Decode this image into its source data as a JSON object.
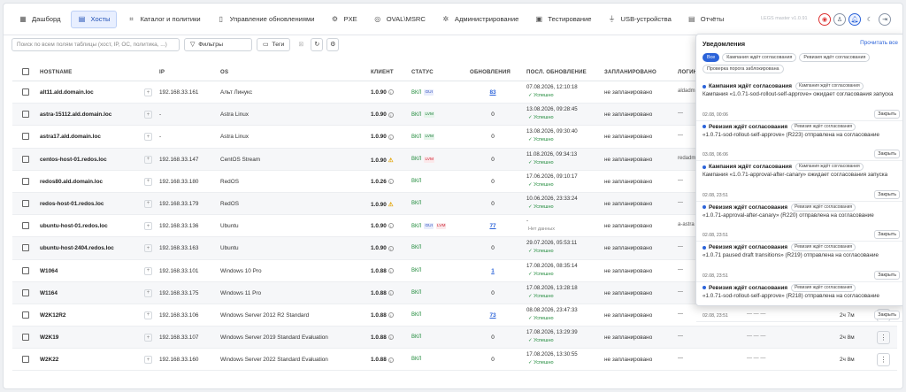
{
  "nav": {
    "tabs": [
      {
        "label": "Дашборд",
        "icon": "grid-icon",
        "glyph": "▦"
      },
      {
        "label": "Хосты",
        "icon": "server-icon",
        "glyph": "▤"
      },
      {
        "label": "Каталог и политики",
        "icon": "tag-icon",
        "glyph": "⌗"
      },
      {
        "label": "Управление обновлениями",
        "icon": "file-icon",
        "glyph": "▯"
      },
      {
        "label": "PXE",
        "icon": "gear-icon",
        "glyph": "⚙"
      },
      {
        "label": "OVAL\\MSRC",
        "icon": "shield-icon",
        "glyph": "◎"
      },
      {
        "label": "Администрирование",
        "icon": "wrench-icon",
        "glyph": "✲"
      },
      {
        "label": "Тестирование",
        "icon": "test-icon",
        "glyph": "▣"
      },
      {
        "label": "USB-устройства",
        "icon": "usb-icon",
        "glyph": "⏚"
      },
      {
        "label": "Отчёты",
        "icon": "report-icon",
        "glyph": "▤"
      }
    ],
    "version": "LEGS master v1.0.91"
  },
  "toolbar": {
    "search_placeholder": "Поиск по всем полям таблицы (хост, IP, ОС, политика, ...)",
    "filters_label": "Фильтры",
    "tags_label": "Теги"
  },
  "table": {
    "headers": {
      "hostname": "HOSTNAME",
      "ip": "IP",
      "os": "OS",
      "client": "КЛИЕНТ",
      "status": "СТАТУС",
      "updates": "ОБНОВЛЕНИЯ",
      "last_update": "ПОСЛ. ОБНОВЛЕНИЕ",
      "scheduled": "ЗАПЛАНИРОВАНО",
      "login": "ЛОГИН"
    },
    "rows": [
      {
        "host": "alt11.ald.domain.loc",
        "ip": "192.168.33.161",
        "os": "Альт Линукс",
        "client": "1.0.90",
        "warn": false,
        "status": "ВКЛ",
        "badges": [
          [
            "GUI",
            "gui"
          ]
        ],
        "updates": "83",
        "link": true,
        "date": "07.08.2026, 12:10:18",
        "result": "✓ Успешно",
        "plan": "не запланировано",
        "cut": "aldadm",
        "age": "",
        "kebab": false
      },
      {
        "host": "astra-15112.ald.domain.loc",
        "ip": "-",
        "os": "Astra Linux",
        "client": "1.0.90",
        "warn": false,
        "status": "ВКЛ",
        "badges": [
          [
            "LVM",
            "lvm"
          ]
        ],
        "updates": "0",
        "link": false,
        "date": "13.08.2026, 09:28:45",
        "result": "✓ Успешно",
        "plan": "не запланировано",
        "cut": "—",
        "age": "",
        "kebab": false
      },
      {
        "host": "astra17.ald.domain.loc",
        "ip": "-",
        "os": "Astra Linux",
        "client": "1.0.90",
        "warn": false,
        "status": "ВКЛ",
        "badges": [
          [
            "LVM",
            "lvm"
          ]
        ],
        "updates": "0",
        "link": false,
        "date": "13.08.2026, 09:30:40",
        "result": "✓ Успешно",
        "plan": "не запланировано",
        "cut": "—",
        "age": "",
        "kebab": false
      },
      {
        "host": "centos-host-01.redos.loc",
        "ip": "192.168.33.147",
        "os": "CentOS Stream",
        "client": "1.0.90",
        "warn": true,
        "status": "ВКЛ",
        "badges": [
          [
            "LVM",
            "lvmr"
          ]
        ],
        "updates": "0",
        "link": false,
        "date": "11.08.2026, 09:34:13",
        "result": "✓ Успешно",
        "plan": "не запланировано",
        "cut": "redadmin",
        "age": "",
        "kebab": false
      },
      {
        "host": "redos80.ald.domain.loc",
        "ip": "192.168.33.180",
        "os": "RedOS",
        "client": "1.0.26",
        "warn": false,
        "status": "ВКЛ",
        "badges": [],
        "updates": "0",
        "link": false,
        "date": "17.06.2026, 09:10:17",
        "result": "✓ Успешно",
        "plan": "не запланировано",
        "cut": "—",
        "age": "",
        "kebab": false
      },
      {
        "host": "redos-host-01.redos.loc",
        "ip": "192.168.33.179",
        "os": "RedOS",
        "client": "1.0.90",
        "warn": true,
        "status": "ВКЛ",
        "badges": [],
        "updates": "0",
        "link": false,
        "date": "10.06.2026, 23:33:24",
        "result": "✓ Успешно",
        "plan": "не запланировано",
        "cut": "—",
        "age": "",
        "kebab": false
      },
      {
        "host": "ubuntu-host-01.redos.loc",
        "ip": "192.168.33.136",
        "os": "Ubuntu",
        "client": "1.0.90",
        "warn": false,
        "status": "ВКЛ",
        "badges": [
          [
            "GUI",
            "gui"
          ],
          [
            "LVM",
            "lvmr"
          ]
        ],
        "updates": "77",
        "link": true,
        "date": "-",
        "result": "Нет данных",
        "nodata": true,
        "plan": "не запланировано",
        "cut": "a-astra",
        "age": "",
        "kebab": false
      },
      {
        "host": "ubuntu-host-2404.redos.loc",
        "ip": "192.168.33.163",
        "os": "Ubuntu",
        "client": "1.0.90",
        "warn": false,
        "status": "ВКЛ",
        "badges": [],
        "updates": "0",
        "link": false,
        "date": "29.07.2026, 05:53:11",
        "result": "✓ Успешно",
        "plan": "не запланировано",
        "cut": "—",
        "age": "",
        "kebab": false
      },
      {
        "host": "W1064",
        "ip": "192.168.33.101",
        "os": "Windows 10 Pro",
        "client": "1.0.88",
        "warn": false,
        "status": "ВКЛ",
        "badges": [],
        "updates": "1",
        "link": true,
        "date": "17.08.2026, 08:35:14",
        "result": "✓ Успешно",
        "plan": "не запланировано",
        "cut": "—",
        "age": "",
        "kebab": false
      },
      {
        "host": "W1164",
        "ip": "192.168.33.175",
        "os": "Windows 11 Pro",
        "client": "1.0.88",
        "warn": false,
        "status": "ВКЛ",
        "badges": [],
        "updates": "0",
        "link": false,
        "date": "17.08.2026, 13:28:18",
        "result": "✓ Успешно",
        "plan": "не запланировано",
        "cut": "—",
        "age": "",
        "kebab": false
      },
      {
        "host": "W2K12R2",
        "ip": "192.168.33.106",
        "os": "Windows Server 2012 R2 Standard",
        "client": "1.0.88",
        "warn": false,
        "status": "ВКЛ",
        "badges": [],
        "updates": "73",
        "link": true,
        "date": "08.08.2026, 23:47:33",
        "result": "✓ Успешно",
        "plan": "не запланировано",
        "cut": "—",
        "age": "2ч 7м",
        "kebab": true
      },
      {
        "host": "W2K19",
        "ip": "192.168.33.107",
        "os": "Windows Server 2019 Standard Evaluation",
        "client": "1.0.88",
        "warn": false,
        "status": "ВКЛ",
        "badges": [],
        "updates": "0",
        "link": false,
        "date": "17.08.2026, 13:29:39",
        "result": "✓ Успешно",
        "plan": "не запланировано",
        "cut": "—",
        "age": "2ч 8м",
        "kebab": true
      },
      {
        "host": "W2K22",
        "ip": "192.168.33.160",
        "os": "Windows Server 2022 Standard Evaluation",
        "client": "1.0.88",
        "warn": false,
        "status": "ВКЛ",
        "badges": [],
        "updates": "0",
        "link": false,
        "date": "17.08.2026, 13:30:55",
        "result": "✓ Успешно",
        "plan": "не запланировано",
        "cut": "—",
        "age": "2ч 8м",
        "kebab": true
      }
    ]
  },
  "notifications": {
    "title": "Уведомления",
    "read_all": "Прочитать все",
    "chips": [
      "Все",
      "Кампания ждёт согласования",
      "Ревизия ждёт согласования",
      "Проверка порога заблокирована"
    ],
    "items": [
      {
        "title": "Кампания ждёт согласования",
        "tag": "Кампания ждёт согласования",
        "text": "Кампания «1.0.71-sod-rollout-self-approve» ожидает согласования запуска",
        "date": "02.08, 00:06",
        "close": "Закрыть"
      },
      {
        "title": "Ревизия ждёт согласования",
        "tag": "Ревизия ждёт согласования",
        "text": "«1.0.71-sod-rollout-self-approve» (R223) отправлена на согласование",
        "date": "03.08, 06:06",
        "close": "Закрыть"
      },
      {
        "title": "Кампания ждёт согласования",
        "tag": "Кампания ждёт согласования",
        "text": "Кампания «1.0.71-approval-after-canary» ожидает согласования запуска",
        "date": "02.08, 23:51",
        "close": "Закрыть"
      },
      {
        "title": "Ревизия ждёт согласования",
        "tag": "Ревизия ждёт согласования",
        "text": "«1.0.71-approval-after-canary» (R220) отправлена на согласование",
        "date": "02.08, 23:51",
        "close": "Закрыть"
      },
      {
        "title": "Ревизия ждёт согласования",
        "tag": "Ревизия ждёт согласования",
        "text": "«1.0.71 paused draft transitions» (R219) отправлена на согласование",
        "date": "02.08, 23:51",
        "close": "Закрыть"
      },
      {
        "title": "Ревизия ждёт согласования",
        "tag": "Ревизия ждёт согласования",
        "text": "«1.0.71-sod-rollout-self-approve» (R218) отправлена на согласование",
        "date": "02.08, 23:51",
        "close": "Закрыть"
      }
    ]
  }
}
